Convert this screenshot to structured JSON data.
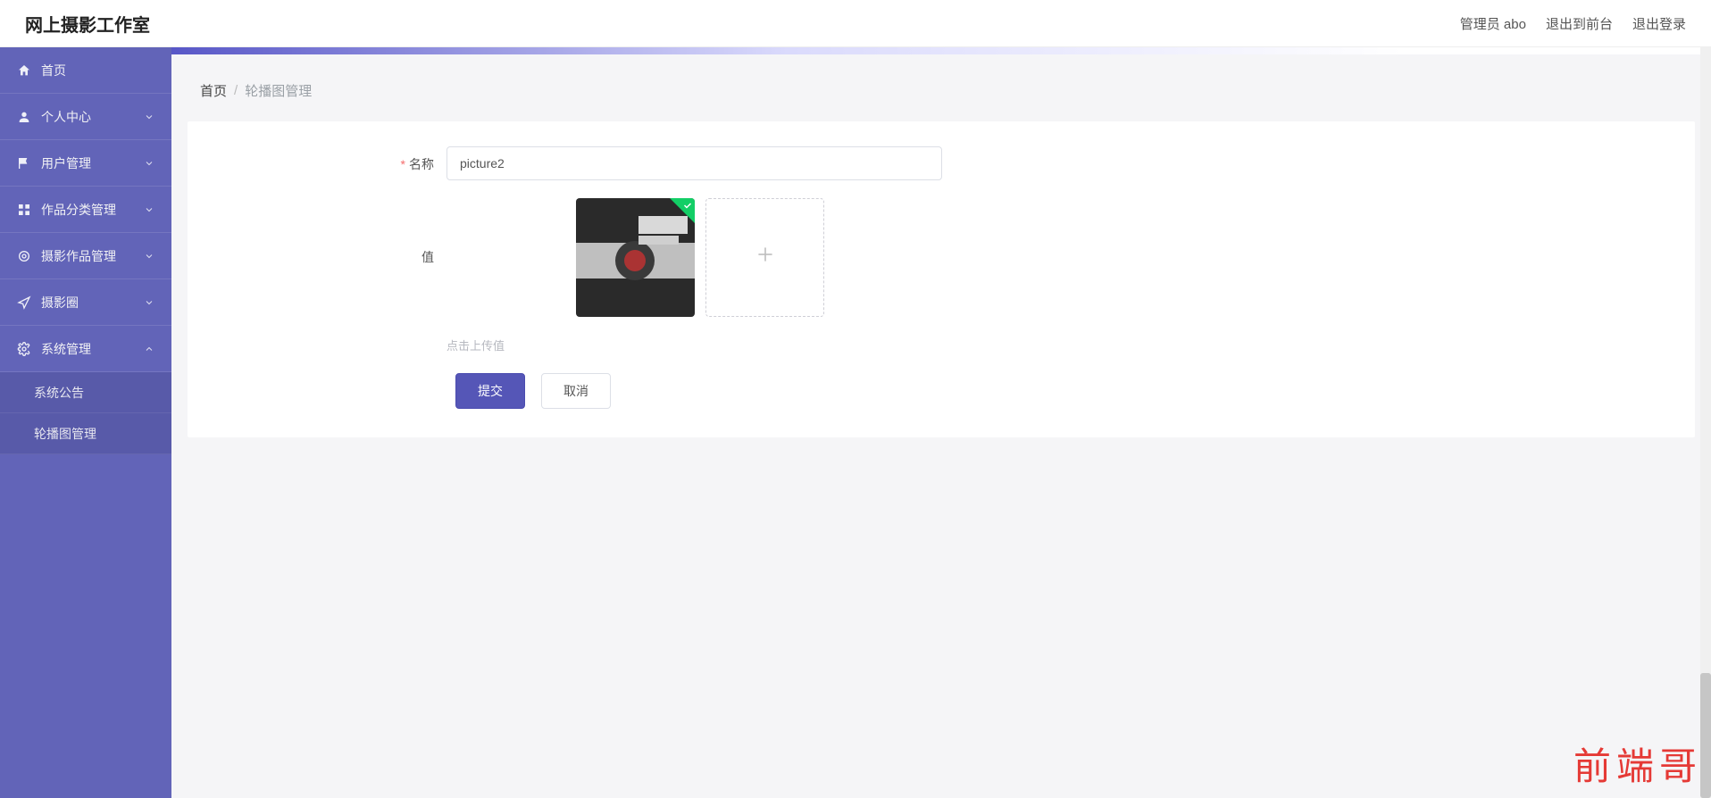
{
  "header": {
    "logo": "网上摄影工作室",
    "links": {
      "admin": "管理员 abo",
      "to_front": "退出到前台",
      "logout": "退出登录"
    }
  },
  "sidebar": {
    "items": [
      {
        "icon": "home-icon",
        "label": "首页"
      },
      {
        "icon": "person-icon",
        "label": "个人中心",
        "expandable": true
      },
      {
        "icon": "flag-icon",
        "label": "用户管理",
        "expandable": true
      },
      {
        "icon": "grid-icon",
        "label": "作品分类管理",
        "expandable": true
      },
      {
        "icon": "target-icon",
        "label": "摄影作品管理",
        "expandable": true
      },
      {
        "icon": "nav-icon",
        "label": "摄影圈",
        "expandable": true
      },
      {
        "icon": "gear-icon",
        "label": "系统管理",
        "expandable": true,
        "expanded": true
      }
    ],
    "submenu": [
      {
        "label": "系统公告"
      },
      {
        "label": "轮播图管理"
      }
    ]
  },
  "breadcrumb": {
    "home": "首页",
    "sep": "/",
    "current": "轮播图管理"
  },
  "form": {
    "name_label": "名称",
    "name_value": "picture2",
    "value_label": "值",
    "upload_hint": "点击上传值",
    "submit": "提交",
    "cancel": "取消"
  },
  "watermark": "前端哥"
}
